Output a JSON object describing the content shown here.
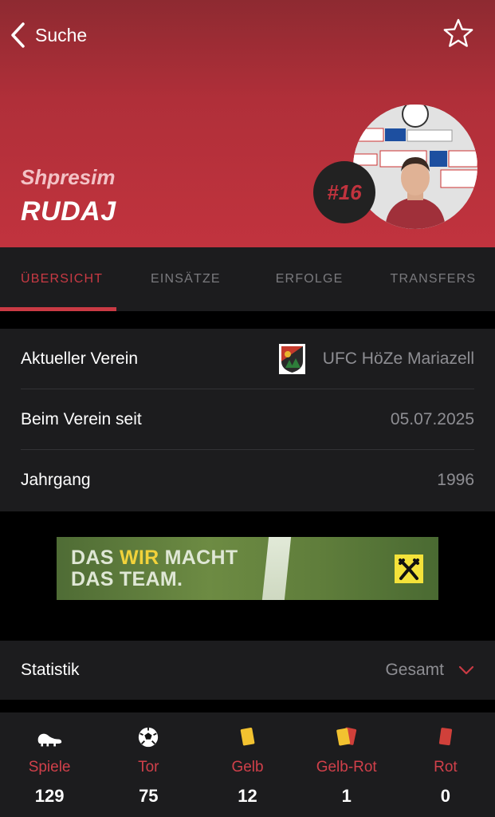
{
  "nav": {
    "back_label": "Suche"
  },
  "player": {
    "first_name": "Shpresim",
    "last_name": "RUDAJ",
    "number": "#16"
  },
  "tabs": [
    {
      "label": "ÜBERSICHT",
      "active": true
    },
    {
      "label": "EINSÄTZE",
      "active": false
    },
    {
      "label": "ERFOLGE",
      "active": false
    },
    {
      "label": "TRANSFERS",
      "active": false
    }
  ],
  "info": [
    {
      "label": "Aktueller Verein",
      "value": "UFC HöZe Mariazell"
    },
    {
      "label": "Beim Verein seit",
      "value": "05.07.2025"
    },
    {
      "label": "Jahrgang",
      "value": "1996"
    }
  ],
  "ad": {
    "text_part1": "DAS ",
    "text_highlight": "WIR",
    "text_part2": " MACHT",
    "text_line2": "DAS TEAM."
  },
  "statistics": {
    "label": "Statistik",
    "filter": "Gesamt"
  },
  "stats": [
    {
      "name": "Spiele",
      "value": "129",
      "icon": "boot-icon"
    },
    {
      "name": "Tor",
      "value": "75",
      "icon": "soccer-ball-icon"
    },
    {
      "name": "Gelb",
      "value": "12",
      "icon": "yellow-card-icon"
    },
    {
      "name": "Gelb-Rot",
      "value": "1",
      "icon": "yellow-red-card-icon"
    },
    {
      "name": "Rot",
      "value": "0",
      "icon": "red-card-icon"
    }
  ],
  "colors": {
    "accent": "#c93a44",
    "header": "#b02f39",
    "panel": "#1c1c1e"
  }
}
